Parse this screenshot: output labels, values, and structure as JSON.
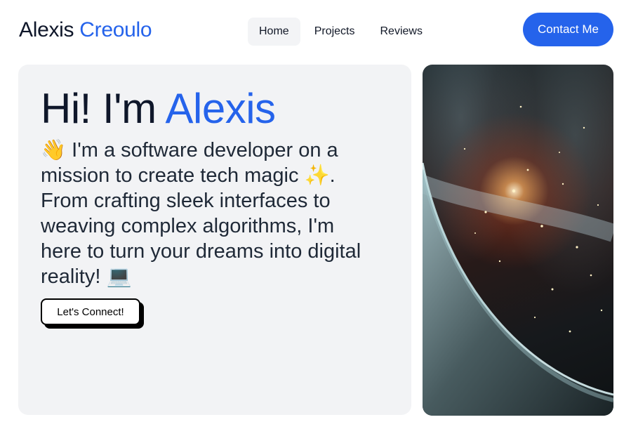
{
  "header": {
    "logo_first": "Alexis",
    "logo_last": "Creoulo",
    "nav": [
      {
        "label": "Home",
        "active": true
      },
      {
        "label": "Projects",
        "active": false
      },
      {
        "label": "Reviews",
        "active": false
      }
    ],
    "contact_label": "Contact Me"
  },
  "hero": {
    "title_prefix": "Hi! I'm",
    "title_name": "Alexis",
    "text": "👋 I'm a software developer on a mission to create tech magic ✨. From crafting sleek interfaces to weaving complex algorithms, I'm here to turn your dreams into digital reality! 💻",
    "cta_label": "Let's Connect!"
  },
  "colors": {
    "accent": "#2563eb",
    "card_bg": "#f2f3f5",
    "nav_active_bg": "#f3f4f6"
  },
  "image": {
    "subject": "space-nebula-planet"
  }
}
